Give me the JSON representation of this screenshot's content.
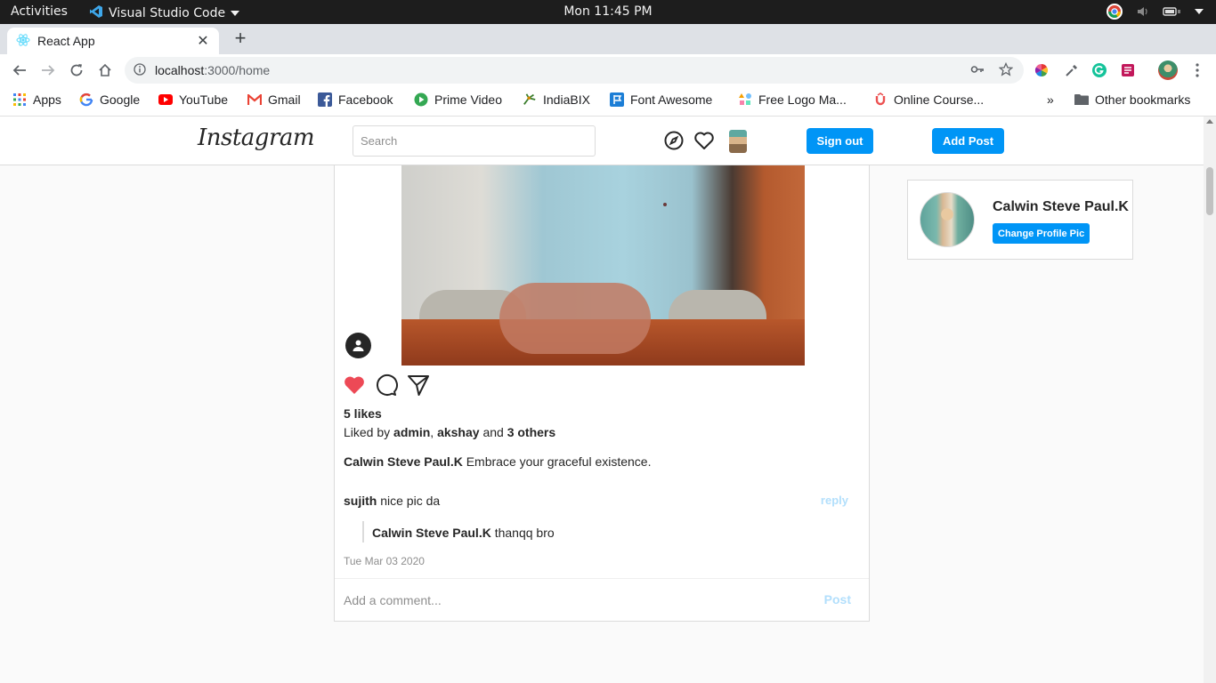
{
  "gnome": {
    "activities": "Activities",
    "app_name": "Visual Studio Code",
    "clock": "Mon 11:45 PM"
  },
  "browser": {
    "tab_title": "React App",
    "url_host": "localhost",
    "url_path": ":3000/home",
    "bookmarks": [
      {
        "label": "Apps",
        "icon": "apps-grid-icon"
      },
      {
        "label": "Google",
        "icon": "google-icon"
      },
      {
        "label": "YouTube",
        "icon": "youtube-icon"
      },
      {
        "label": "Gmail",
        "icon": "gmail-icon"
      },
      {
        "label": "Facebook",
        "icon": "facebook-icon"
      },
      {
        "label": "Prime Video",
        "icon": "prime-video-icon"
      },
      {
        "label": "IndiaBIX",
        "icon": "indiabix-icon"
      },
      {
        "label": "Font Awesome",
        "icon": "flag-icon"
      },
      {
        "label": "Free Logo Ma...",
        "icon": "logo-maker-icon"
      },
      {
        "label": "Online Course...",
        "icon": "udemy-icon"
      }
    ],
    "overflow": "»",
    "other_bookmarks": "Other bookmarks"
  },
  "header": {
    "logo": "Instagram",
    "search_placeholder": "Search",
    "sign_out": "Sign out",
    "add_post": "Add Post"
  },
  "post": {
    "likes": "5 likes",
    "liked_by_prefix": "Liked by",
    "liked_by_users": [
      "admin",
      "akshay"
    ],
    "liked_by_and": "and",
    "liked_by_others": "3 others",
    "author": "Calwin Steve Paul.K",
    "caption": "Embrace your graceful existence.",
    "comments": [
      {
        "user": "sujith",
        "text": "nice pic da",
        "reply_label": "reply",
        "replies": [
          {
            "user": "Calwin Steve Paul.K",
            "text": "thanqq bro"
          }
        ]
      }
    ],
    "date": "Tue Mar 03 2020",
    "comment_placeholder": "Add a comment...",
    "post_button": "Post"
  },
  "profile": {
    "name": "Calwin Steve Paul.K",
    "change_pic": "Change Profile Pic"
  },
  "colors": {
    "accent": "#0095f6",
    "like": "#ed4956",
    "disabled_link": "#b2dffc"
  }
}
